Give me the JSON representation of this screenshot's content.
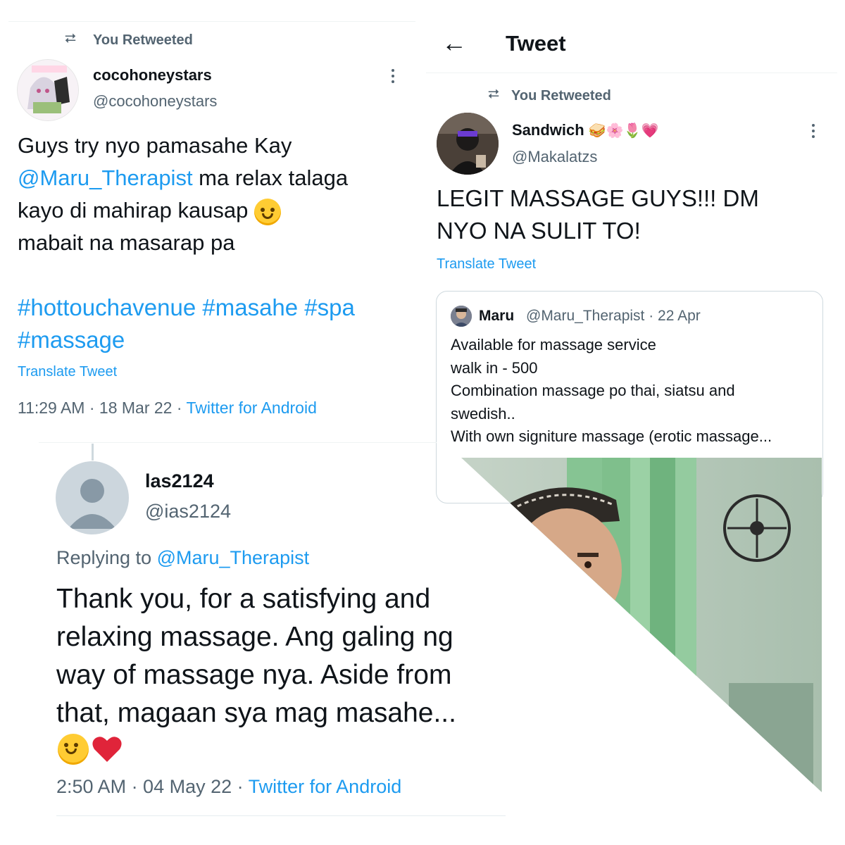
{
  "tweet1": {
    "retweet_label": "You Retweeted",
    "name": "cocohoneystars",
    "handle": "@cocohoneystars",
    "text_line1": "Guys try nyo pamasahe Kay",
    "mention": "@Maru_Therapist",
    "text_line2_rest": " ma relax talaga",
    "text_line3": "kayo di mahirap kausap",
    "text_line4": "mabait na masarap pa",
    "hashtags_line1": "#hottouchavenue #masahe #spa",
    "hashtags_line2": "#massage",
    "translate": "Translate Tweet",
    "time": "11:29 AM · 18 Mar 22 · ",
    "source": "Twitter for Android"
  },
  "tweet2": {
    "back_arrow": "←",
    "header_title": "Tweet",
    "retweet_label": "You Retweeted",
    "name": "Sandwich",
    "name_emojis": "🥪🌸🌷💗",
    "handle": "@Makalatzs",
    "text_line1": "LEGIT MASSAGE GUYS!!! DM",
    "text_line2": "NYO NA SULIT TO!",
    "translate": "Translate Tweet",
    "quote": {
      "name": "Maru",
      "handle_date": "@Maru_Therapist · 22 Apr",
      "line1": "Available for massage service",
      "line2": "walk in - 500",
      "line3": "Combination massage po thai, siatsu and",
      "line4": "swedish..",
      "line5": "With own signiture massage (erotic massage..."
    }
  },
  "tweet3": {
    "name": "las2124",
    "handle": "@ias2124",
    "replying_prefix": "Replying to ",
    "replying_to": "@Maru_Therapist",
    "line1": "Thank you, for a satisfying and",
    "line2": "relaxing massage. Ang galing ng",
    "line3": "way of massage nya. Aside from",
    "line4": "that, magaan sya mag masahe...",
    "time": "2:50 AM · 04 May 22 · ",
    "source": "Twitter for Android"
  },
  "icons": [
    "retweet-icon",
    "more-icon",
    "back-arrow-icon",
    "smile-emoji",
    "heart-emoji",
    "default-avatar-icon"
  ],
  "colors": {
    "link": "#1d9bf0",
    "muted": "#536471",
    "text": "#0f1419",
    "divider": "#eff3f4",
    "curtain": "#8fc79a"
  }
}
